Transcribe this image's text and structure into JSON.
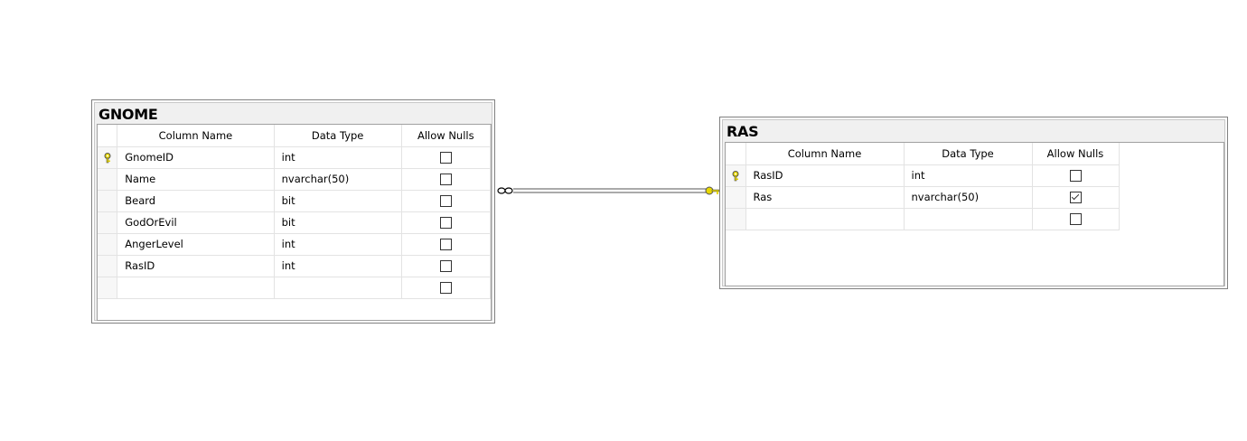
{
  "tables": [
    {
      "name": "GNOME",
      "headers": [
        "Column Name",
        "Data Type",
        "Allow Nulls"
      ],
      "rows": [
        {
          "column": "GnomeID",
          "type": "int",
          "allow_nulls": false,
          "primary_key": true
        },
        {
          "column": "Name",
          "type": "nvarchar(50)",
          "allow_nulls": false,
          "primary_key": false
        },
        {
          "column": "Beard",
          "type": "bit",
          "allow_nulls": false,
          "primary_key": false
        },
        {
          "column": "GodOrEvil",
          "type": "bit",
          "allow_nulls": false,
          "primary_key": false
        },
        {
          "column": "AngerLevel",
          "type": "int",
          "allow_nulls": false,
          "primary_key": false
        },
        {
          "column": "RasID",
          "type": "int",
          "allow_nulls": false,
          "primary_key": false
        },
        {
          "column": "",
          "type": "",
          "allow_nulls": false,
          "primary_key": false
        }
      ]
    },
    {
      "name": "RAS",
      "headers": [
        "Column Name",
        "Data Type",
        "Allow Nulls"
      ],
      "rows": [
        {
          "column": "RasID",
          "type": "int",
          "allow_nulls": false,
          "primary_key": true
        },
        {
          "column": "Ras",
          "type": "nvarchar(50)",
          "allow_nulls": true,
          "primary_key": false
        },
        {
          "column": "",
          "type": "",
          "allow_nulls": false,
          "primary_key": false
        }
      ]
    }
  ],
  "relationship": {
    "from_table": "GNOME",
    "to_table": "RAS",
    "from_end": "many",
    "to_end": "one",
    "key_color": "#e8d800"
  }
}
